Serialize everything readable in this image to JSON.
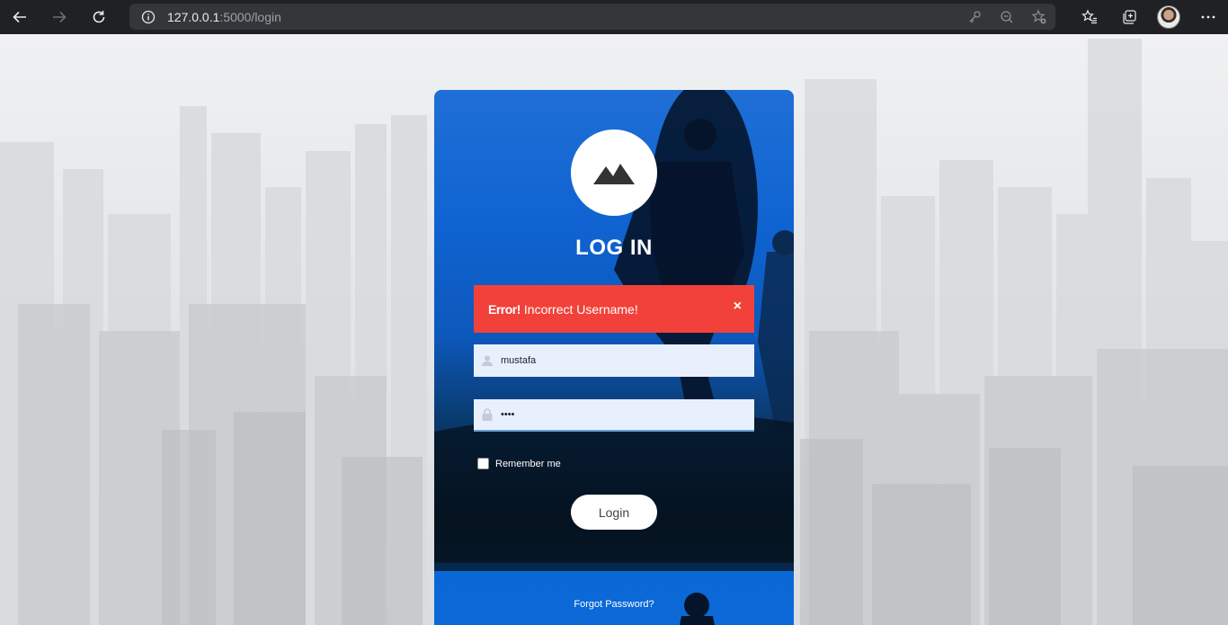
{
  "browser": {
    "url_host": "127.0.0.1",
    "url_path": ":5000/login"
  },
  "login": {
    "title": "LOG IN",
    "error_label": "Error!",
    "error_message": "Incorrect Username!",
    "close_symbol": "×",
    "username_value": "mustafa",
    "password_value": "••••",
    "remember_label": "Remember me",
    "login_button": "Login",
    "forgot_link": "Forgot Password?"
  },
  "colors": {
    "card_blue": "#0f63d1",
    "error_red": "#f1413a",
    "input_bg": "#e8f0fe"
  },
  "icons": [
    "back-icon",
    "forward-icon",
    "reload-icon",
    "info-icon",
    "key-icon",
    "zoom-out-icon",
    "add-favorite-icon",
    "favorites-icon",
    "collections-icon",
    "settings-more-icon",
    "mountain-logo-icon",
    "user-icon",
    "lock-icon",
    "close-icon"
  ]
}
